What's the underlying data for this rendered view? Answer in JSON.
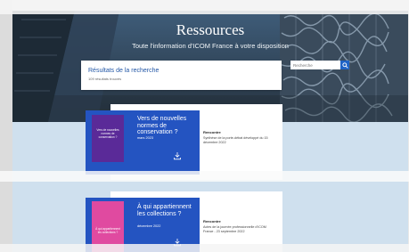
{
  "hero": {
    "title": "Ressources",
    "subtitle": "Toute l'information d'ICOM France à votre disposition"
  },
  "search": {
    "placeholder": "Recherche"
  },
  "results": {
    "title": "Résultats de la recherche",
    "count": "109 résultats trouvés"
  },
  "items": [
    {
      "cover_title": "Vers de nouvelles normes de conservation ?",
      "title": "Vers de nouvelles normes de conservation ?",
      "date": "mars 2023",
      "type": "Rencontre",
      "description": "Synthèse de la porte-débat développé du 15 décembre 2022"
    },
    {
      "cover_title": "À qui appartiennent les collections ?",
      "title": "À qui appartiennent les collections ?",
      "date": "décembre 2022",
      "type": "Rencontre",
      "description": "Actes de la journée professionnelle d'ICOM France - 23 septembre 2022"
    }
  ],
  "colors": {
    "accent_blue": "#2454c1",
    "cover_purple": "#5a2a98",
    "cover_pink": "#e04aa0",
    "page_bg": "#cfe0ee"
  },
  "icons": [
    "search-icon",
    "download-icon"
  ]
}
